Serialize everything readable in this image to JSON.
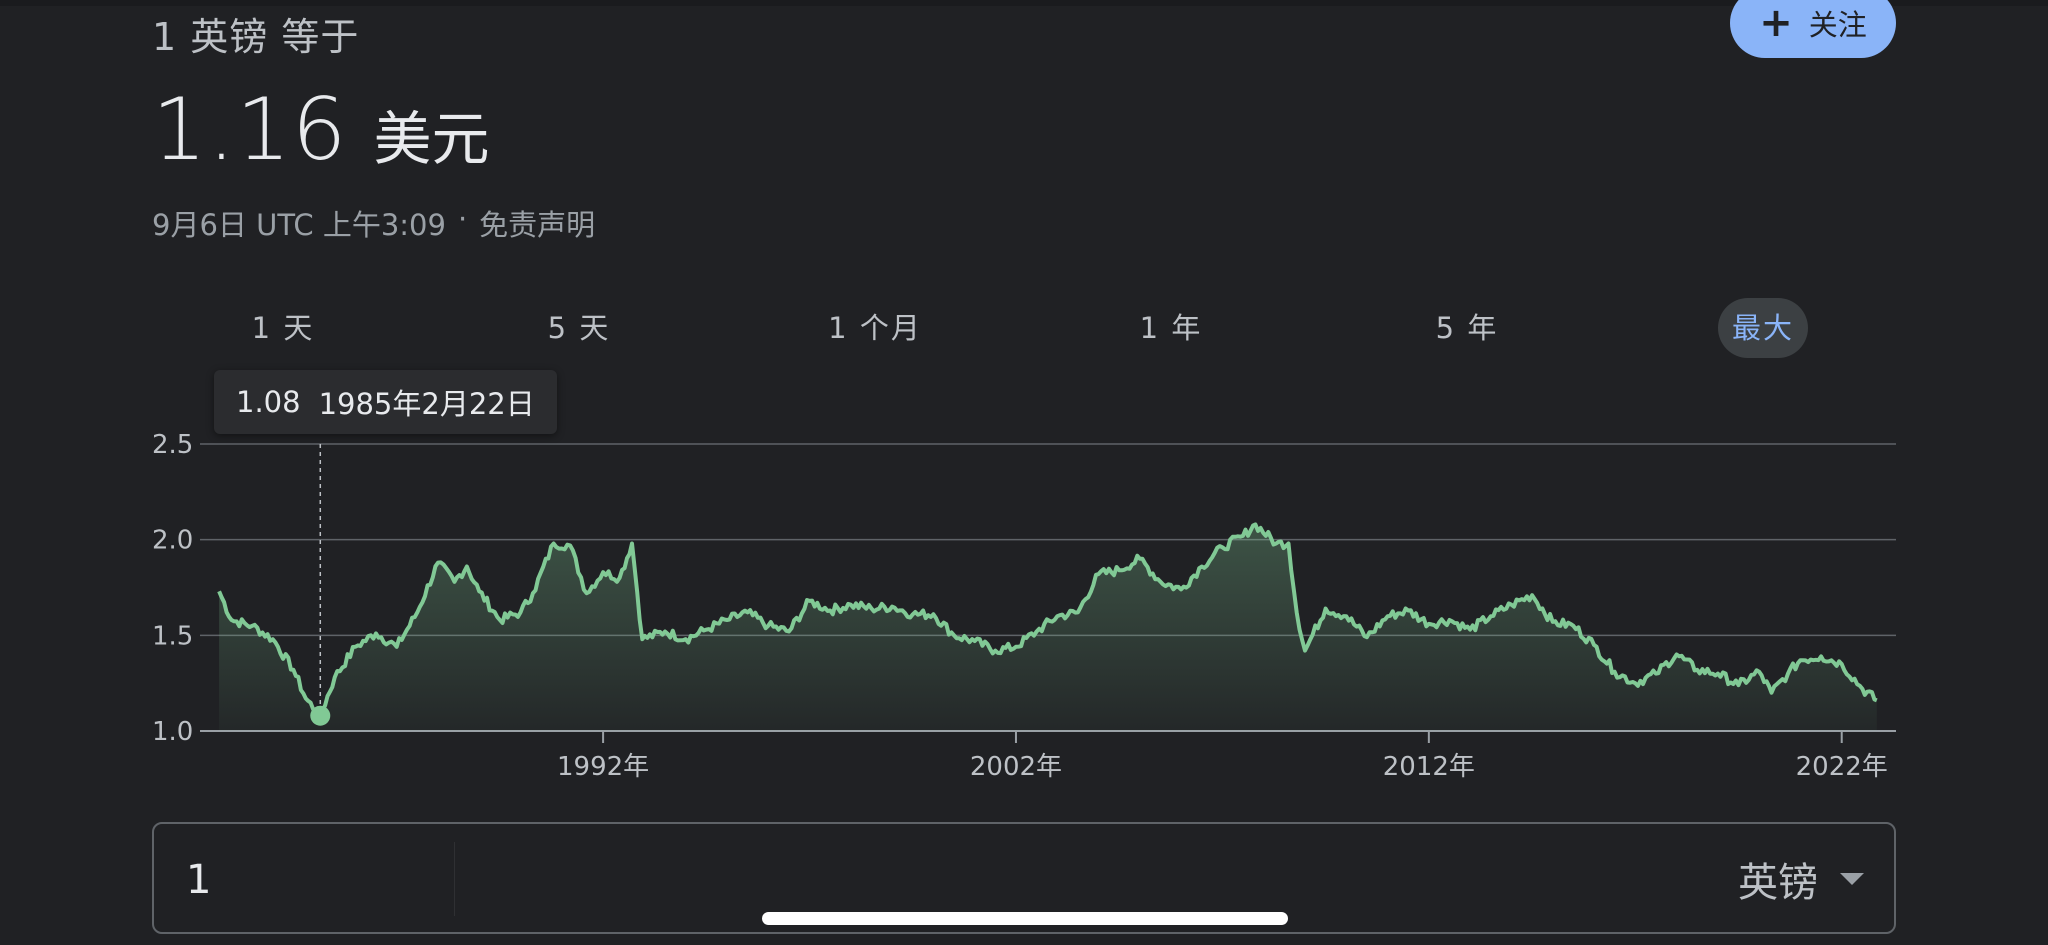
{
  "header": {
    "subtitle": "1 英镑 等于",
    "rate_value": "1.16",
    "rate_unit": "美元",
    "timestamp": "9月6日 UTC 上午3:09",
    "separator": "·",
    "disclaimer": "免责声明",
    "follow_icon": "plus-icon",
    "follow_label": "关注"
  },
  "tabs": [
    {
      "label": "1 天"
    },
    {
      "label": "5 天"
    },
    {
      "label": "1 个月"
    },
    {
      "label": "1 年"
    },
    {
      "label": "5 年"
    },
    {
      "label": "最大",
      "active": true
    }
  ],
  "tooltip": {
    "value": "1.08",
    "date": "1985年2月22日"
  },
  "colors": {
    "background": "#202124",
    "line": "#81c995",
    "accent": "#8ab4f8",
    "grid": "#5f6368"
  },
  "chart_data": {
    "type": "area",
    "ylim": [
      1.0,
      2.5
    ],
    "y_ticks": [
      "1.0",
      "1.5",
      "2.0",
      "2.5"
    ],
    "x_ticks": [
      {
        "year": 1992,
        "label": "1992年"
      },
      {
        "year": 2002,
        "label": "2002年"
      },
      {
        "year": 2012,
        "label": "2012年"
      },
      {
        "year": 2022,
        "label": "2022年"
      }
    ],
    "xlim": [
      1982.6,
      2023.0
    ],
    "grid": true,
    "highlight": {
      "year": 1985.15,
      "value": 1.08
    },
    "series": [
      {
        "points": [
          [
            1982.7,
            1.73
          ],
          [
            1983.0,
            1.58
          ],
          [
            1983.5,
            1.55
          ],
          [
            1984.0,
            1.48
          ],
          [
            1984.5,
            1.32
          ],
          [
            1984.8,
            1.17
          ],
          [
            1985.15,
            1.08
          ],
          [
            1985.5,
            1.28
          ],
          [
            1986.0,
            1.44
          ],
          [
            1986.5,
            1.51
          ],
          [
            1987.0,
            1.44
          ],
          [
            1987.5,
            1.62
          ],
          [
            1988.0,
            1.88
          ],
          [
            1988.4,
            1.78
          ],
          [
            1988.7,
            1.86
          ],
          [
            1989.0,
            1.73
          ],
          [
            1989.5,
            1.58
          ],
          [
            1990.0,
            1.62
          ],
          [
            1990.3,
            1.72
          ],
          [
            1990.8,
            1.98
          ],
          [
            1991.2,
            1.97
          ],
          [
            1991.6,
            1.72
          ],
          [
            1992.0,
            1.83
          ],
          [
            1992.4,
            1.8
          ],
          [
            1992.7,
            1.98
          ],
          [
            1992.95,
            1.48
          ],
          [
            1993.5,
            1.52
          ],
          [
            1994.0,
            1.48
          ],
          [
            1994.5,
            1.53
          ],
          [
            1995.0,
            1.58
          ],
          [
            1995.5,
            1.62
          ],
          [
            1996.0,
            1.55
          ],
          [
            1996.5,
            1.52
          ],
          [
            1997.0,
            1.68
          ],
          [
            1997.5,
            1.63
          ],
          [
            1998.0,
            1.66
          ],
          [
            1998.5,
            1.64
          ],
          [
            1999.0,
            1.65
          ],
          [
            1999.5,
            1.61
          ],
          [
            2000.0,
            1.61
          ],
          [
            2000.5,
            1.5
          ],
          [
            2001.0,
            1.47
          ],
          [
            2001.5,
            1.42
          ],
          [
            2002.0,
            1.44
          ],
          [
            2002.5,
            1.52
          ],
          [
            2003.0,
            1.6
          ],
          [
            2003.5,
            1.62
          ],
          [
            2004.0,
            1.82
          ],
          [
            2004.5,
            1.84
          ],
          [
            2005.0,
            1.9
          ],
          [
            2005.5,
            1.78
          ],
          [
            2006.0,
            1.74
          ],
          [
            2006.5,
            1.86
          ],
          [
            2007.0,
            1.96
          ],
          [
            2007.5,
            2.02
          ],
          [
            2007.8,
            2.08
          ],
          [
            2008.3,
            1.98
          ],
          [
            2008.6,
            1.98
          ],
          [
            2008.8,
            1.62
          ],
          [
            2009.0,
            1.42
          ],
          [
            2009.5,
            1.64
          ],
          [
            2010.0,
            1.6
          ],
          [
            2010.5,
            1.49
          ],
          [
            2011.0,
            1.6
          ],
          [
            2011.5,
            1.63
          ],
          [
            2012.0,
            1.56
          ],
          [
            2012.5,
            1.58
          ],
          [
            2013.0,
            1.53
          ],
          [
            2013.5,
            1.6
          ],
          [
            2014.0,
            1.66
          ],
          [
            2014.5,
            1.71
          ],
          [
            2015.0,
            1.57
          ],
          [
            2015.5,
            1.55
          ],
          [
            2016.0,
            1.45
          ],
          [
            2016.5,
            1.31
          ],
          [
            2017.0,
            1.25
          ],
          [
            2017.5,
            1.3
          ],
          [
            2018.0,
            1.4
          ],
          [
            2018.5,
            1.32
          ],
          [
            2019.0,
            1.3
          ],
          [
            2019.5,
            1.24
          ],
          [
            2020.0,
            1.31
          ],
          [
            2020.3,
            1.2
          ],
          [
            2020.7,
            1.3
          ],
          [
            2021.0,
            1.37
          ],
          [
            2021.5,
            1.39
          ],
          [
            2022.0,
            1.35
          ],
          [
            2022.5,
            1.22
          ],
          [
            2022.85,
            1.16
          ]
        ]
      }
    ]
  },
  "converter": {
    "amount": "1",
    "currency": "英镑"
  }
}
